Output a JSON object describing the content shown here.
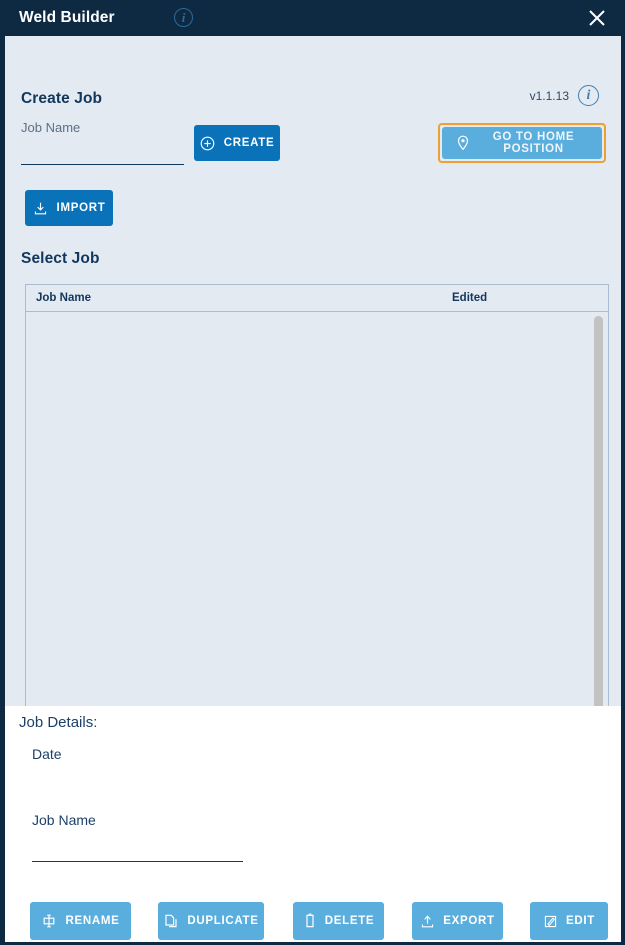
{
  "window": {
    "title": "Weld Builder",
    "info_icon": "info-circle-icon",
    "close_icon": "close-icon",
    "titlebar_color": "#0d2a42"
  },
  "create_job": {
    "heading": "Create Job",
    "version": "v1.1.13",
    "version_info_icon": "info-circle-icon",
    "job_name": {
      "label": "Job Name",
      "value": "",
      "placeholder": ""
    },
    "create_button": {
      "label": "CREATE",
      "icon": "plus-circle-icon",
      "color": "#0a72b9"
    },
    "import_button": {
      "label": "IMPORT",
      "icon": "download-icon",
      "color": "#0a72b9"
    },
    "home_button": {
      "label": "GO TO HOME POSITION",
      "icon": "map-pin-icon",
      "color": "#5aaede",
      "focus_ring_color": "#eda033"
    }
  },
  "select_job": {
    "heading": "Select Job",
    "columns": [
      "Job Name",
      "Edited"
    ],
    "rows": [],
    "scrollbar": "vertical-scrollbar"
  },
  "job_details": {
    "heading": "Job Details:",
    "date_label": "Date",
    "date_value": "",
    "job_name_label": "Job Name",
    "job_name_value": "",
    "job_name_placeholder": ""
  },
  "actions": [
    {
      "label": "RENAME",
      "icon": "rename-icon"
    },
    {
      "label": "DUPLICATE",
      "icon": "copy-icon"
    },
    {
      "label": "DELETE",
      "icon": "trash-icon"
    },
    {
      "label": "EXPORT",
      "icon": "upload-icon"
    },
    {
      "label": "EDIT",
      "icon": "pencil-square-icon"
    }
  ]
}
